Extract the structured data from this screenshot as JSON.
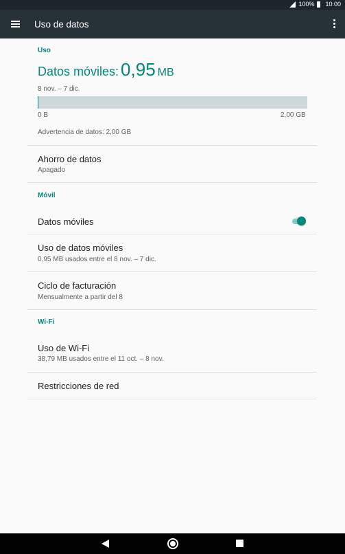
{
  "status_bar": {
    "battery_text": "100%",
    "time": "10:00",
    "icons": [
      "signal-icon",
      "battery-icon"
    ]
  },
  "app_bar": {
    "title": "Uso de datos",
    "icons": [
      "menu-icon",
      "more-vert-icon"
    ]
  },
  "usage_section": {
    "label": "Uso",
    "mobile_data_label": "Datos móviles:",
    "mobile_data_value": "0,95",
    "mobile_data_unit": "MB",
    "period": "8 nov. – 7 dic.",
    "bar_fraction": 0.0005,
    "bar_min_label": "0 B",
    "bar_max_label": "2,00 GB",
    "warning_text": "Advertencia de datos: 2,00 GB"
  },
  "data_saver": {
    "title": "Ahorro de datos",
    "subtitle": "Apagado"
  },
  "mobile_section": {
    "label": "Móvil",
    "mobile_data_toggle_label": "Datos móviles",
    "mobile_data_toggle_on": true,
    "usage_title": "Uso de datos móviles",
    "usage_subtitle": "0,95 MB usados entre el 8 nov. – 7 dic.",
    "billing_title": "Ciclo de facturación",
    "billing_subtitle": "Mensualmente a partir del 8"
  },
  "wifi_section": {
    "label": "Wi-Fi",
    "usage_title": "Uso de Wi-Fi",
    "usage_subtitle": "38,79 MB usados entre el 11 oct. – 8 nov.",
    "restrictions_title": "Restricciones de red"
  },
  "colors": {
    "accent": "#00897b",
    "app_bar": "#263238",
    "status_bar": "#1d252c",
    "background": "#fafafa"
  },
  "nav_bar": {
    "icons": [
      "back-icon",
      "home-icon",
      "recents-icon"
    ]
  }
}
